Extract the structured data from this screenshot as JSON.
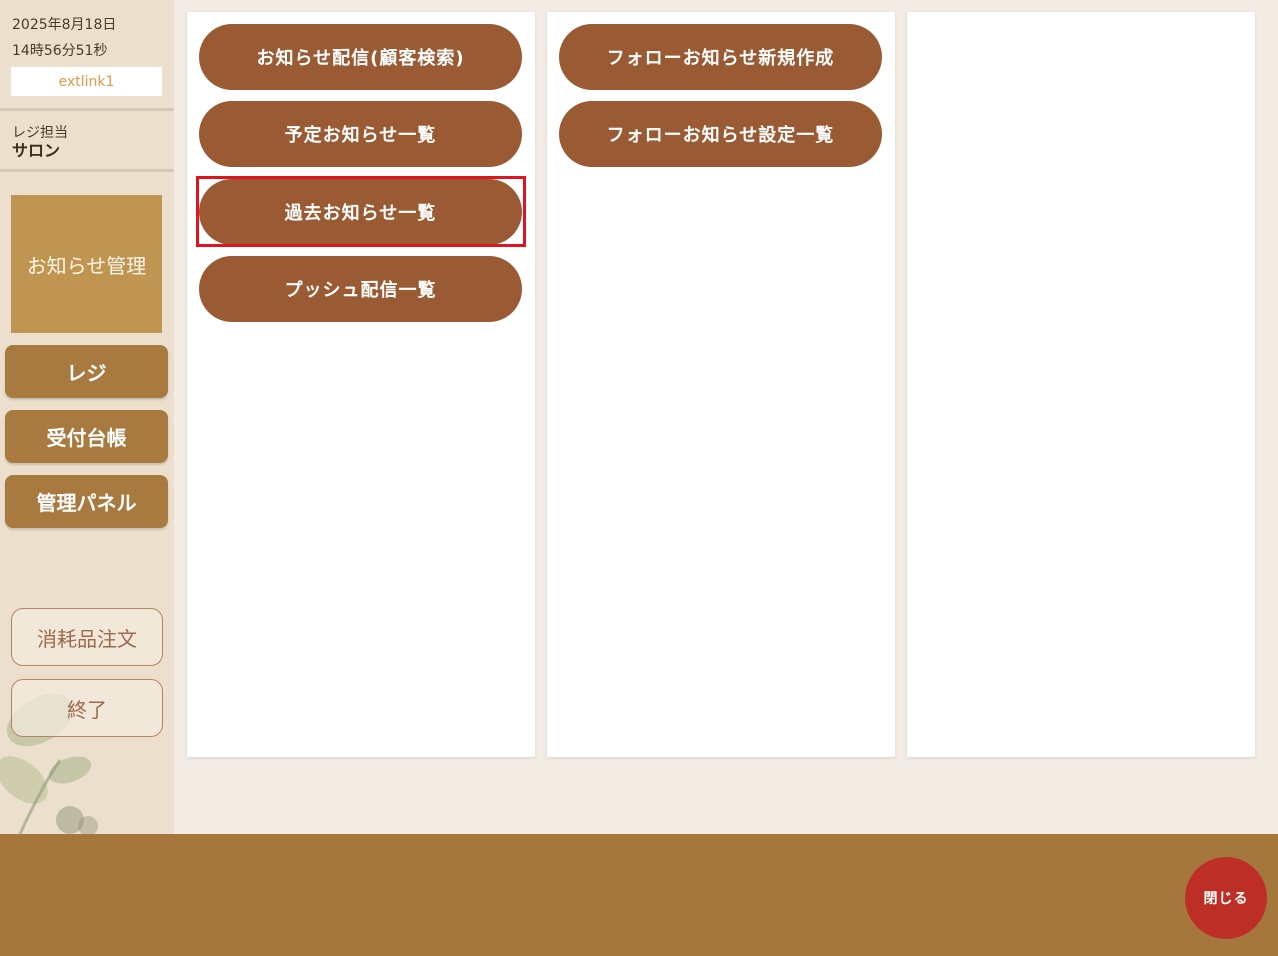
{
  "sidebar": {
    "date": "2025年8月18日",
    "time": "14時56分51秒",
    "link_label": "extlink1",
    "role_label": "レジ担当",
    "role_value": "サロン",
    "current_section": "お知らせ管理",
    "nav": {
      "register": "レジ",
      "reception": "受付台帳",
      "admin_panel": "管理パネル"
    },
    "supplies_order": "消耗品注文",
    "exit": "終了"
  },
  "panel1": {
    "items": [
      "お知らせ配信(顧客検索)",
      "予定お知らせ一覧",
      "過去お知らせ一覧",
      "プッシュ配信一覧"
    ]
  },
  "panel2": {
    "items": [
      "フォローお知らせ新規作成",
      "フォローお知らせ設定一覧"
    ]
  },
  "footer": {
    "close_label": "閉じる"
  },
  "colors": {
    "sidebar_bg": "#ecdfcd",
    "accent_brown": "#9a5a33",
    "nav_brown": "#a87a40",
    "current_gold": "#c09552",
    "footer_brown": "#a5773c",
    "close_red": "#bd2f26",
    "highlight_red": "#e0141e"
  }
}
